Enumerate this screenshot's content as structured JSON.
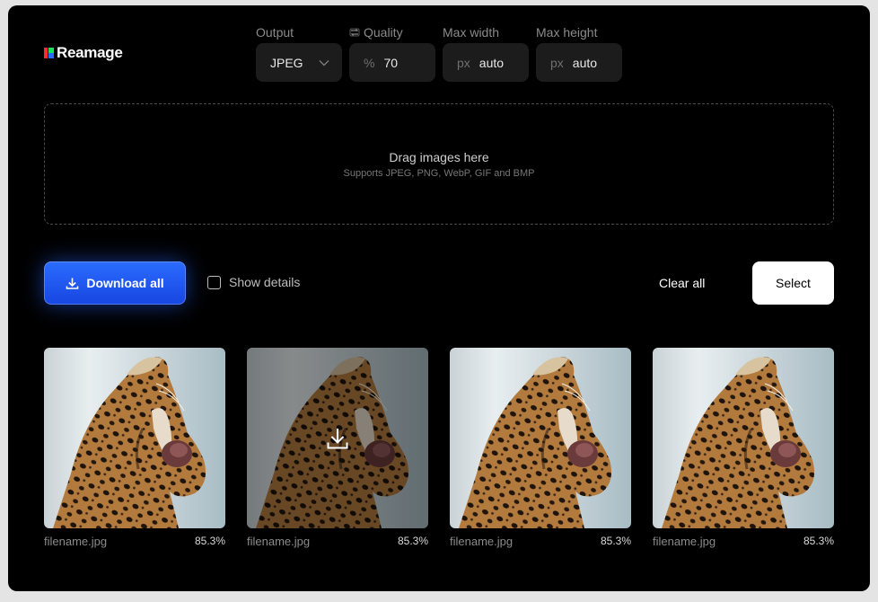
{
  "app": {
    "name": "Reamage"
  },
  "settings": {
    "output": {
      "label": "Output",
      "value": "JPEG"
    },
    "quality": {
      "label": "Quality",
      "unit": "%",
      "value": "70"
    },
    "max_width": {
      "label": "Max width",
      "unit": "px",
      "value": "auto"
    },
    "max_height": {
      "label": "Max height",
      "unit": "px",
      "value": "auto"
    }
  },
  "dropzone": {
    "title": "Drag images here",
    "subtitle": "Supports JPEG, PNG, WebP, GIF and BMP"
  },
  "actions": {
    "download_all": "Download all",
    "show_details": "Show details",
    "clear_all": "Clear all",
    "select": "Select"
  },
  "images": [
    {
      "filename": "filename.jpg",
      "ratio": "85.3%"
    },
    {
      "filename": "filename.jpg",
      "ratio": "85.3%",
      "hovered": true
    },
    {
      "filename": "filename.jpg",
      "ratio": "85.3%"
    },
    {
      "filename": "filename.jpg",
      "ratio": "85.3%"
    }
  ],
  "colors": {
    "accent": "#1f55f0",
    "background": "#000000",
    "field_bg": "#1c1c1c"
  },
  "icons": [
    "logo-mark-icon",
    "quality-icon",
    "chevron-down-icon",
    "download-icon",
    "checkbox-icon"
  ]
}
